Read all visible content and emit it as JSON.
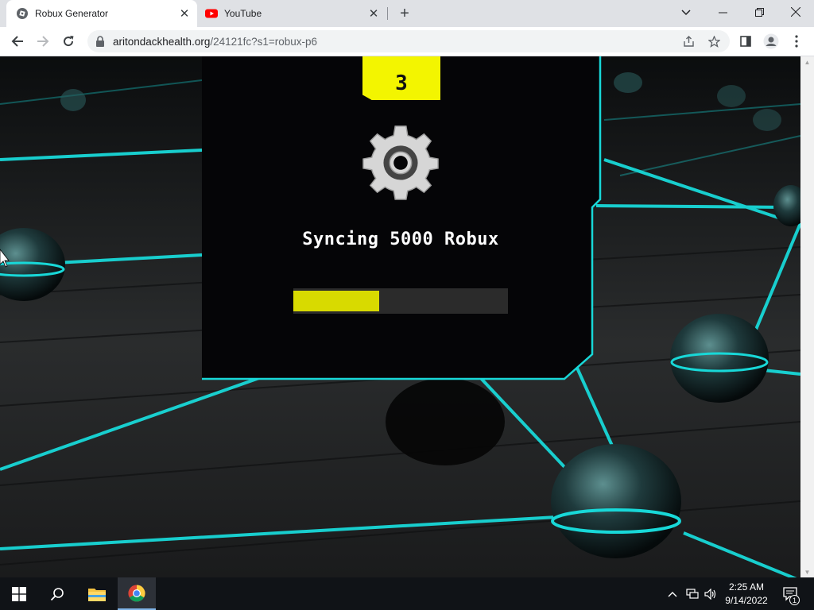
{
  "browser": {
    "tabs": [
      {
        "title": "Robux Generator",
        "favicon": "roblox-logo-icon",
        "active": true
      },
      {
        "title": "YouTube",
        "favicon": "youtube-logo-icon",
        "active": false
      }
    ],
    "url_host": "aritondackhealth.org",
    "url_path": "/24121fc?s1=robux-p6"
  },
  "page": {
    "counter": "3",
    "status_text": "Syncing 5000 Robux",
    "progress_fraction": 0.4,
    "accent_color": "#f3f500",
    "line_color": "#18d8d8"
  },
  "taskbar": {
    "time": "2:25 AM",
    "date": "9/14/2022",
    "notification_count": "1"
  }
}
